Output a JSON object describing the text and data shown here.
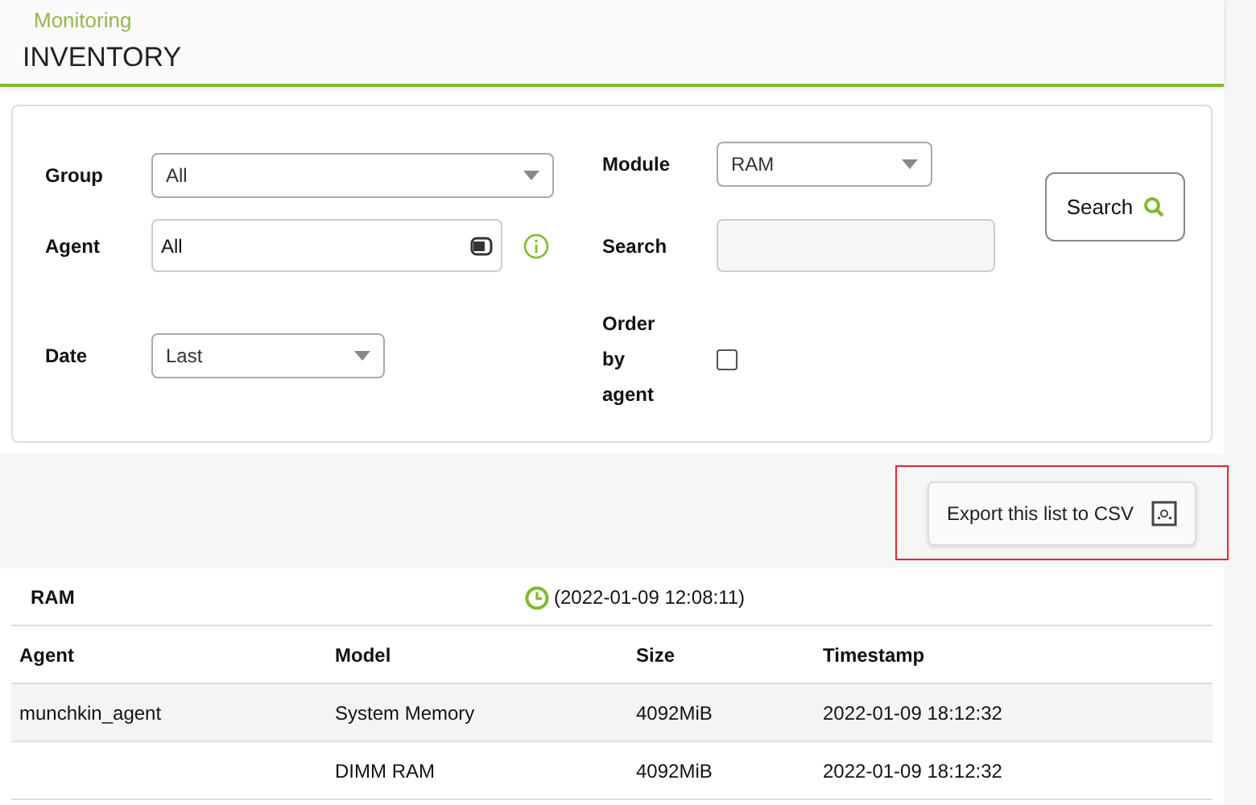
{
  "header": {
    "breadcrumb": "Monitoring",
    "title": "INVENTORY"
  },
  "filters": {
    "group": {
      "label": "Group",
      "value": "All"
    },
    "agent": {
      "label": "Agent",
      "value": "All"
    },
    "date": {
      "label": "Date",
      "value": "Last"
    },
    "module": {
      "label": "Module",
      "value": "RAM"
    },
    "search": {
      "label": "Search"
    },
    "order_by_agent": {
      "label": "Order by agent",
      "checked": false
    },
    "search_button": "Search"
  },
  "export": {
    "label": "Export this list to CSV",
    "highlighted": true
  },
  "table": {
    "title": "RAM",
    "timestamp": "(2022-01-09 12:08:11)",
    "columns": [
      "Agent",
      "Model",
      "Size",
      "Timestamp"
    ],
    "rows": [
      {
        "cells": [
          "munchkin_agent",
          "System Memory",
          "4092MiB",
          "2022-01-09 18:12:32"
        ]
      },
      {
        "cells": [
          "",
          "DIMM RAM",
          "4092MiB",
          "2022-01-09 18:12:32"
        ]
      }
    ]
  }
}
